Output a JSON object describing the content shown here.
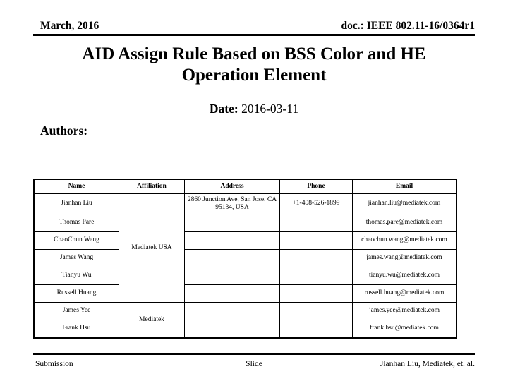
{
  "header": {
    "left": "March, 2016",
    "right": "doc.: IEEE 802.11-16/0364r1"
  },
  "title": "AID Assign Rule Based on BSS Color and HE Operation Element",
  "date": {
    "label": "Date:",
    "value": "2016-03-11"
  },
  "authors_label": "Authors:",
  "authors_table": {
    "columns": [
      "Name",
      "Affiliation",
      "Address",
      "Phone",
      "Email"
    ],
    "rows": [
      {
        "name": "Jianhan Liu",
        "affiliation": "Mediatek USA",
        "address": "2860 Junction Ave, San Jose, CA 95134, USA",
        "phone": "+1-408-526-1899",
        "email": "jianhan.liu@mediatek.com"
      },
      {
        "name": "Thomas Pare",
        "affiliation": "",
        "address": "",
        "phone": "",
        "email": "thomas.pare@mediatek.com"
      },
      {
        "name": "ChaoChun Wang",
        "affiliation": "",
        "address": "",
        "phone": "",
        "email": "chaochun.wang@mediatek.com"
      },
      {
        "name": "James Wang",
        "affiliation": "",
        "address": "",
        "phone": "",
        "email": "james.wang@mediatek.com"
      },
      {
        "name": "Tianyu Wu",
        "affiliation": "",
        "address": "",
        "phone": "",
        "email": "tianyu.wu@mediatek.com"
      },
      {
        "name": "Russell Huang",
        "affiliation": "",
        "address": "",
        "phone": "",
        "email": "russell.huang@mediatek.com"
      },
      {
        "name": "James Yee",
        "affiliation": "Mediatek",
        "address": "",
        "phone": "",
        "email": "james.yee@mediatek.com"
      },
      {
        "name": "Frank Hsu",
        "affiliation": "",
        "address": "",
        "phone": "",
        "email": "frank.hsu@mediatek.com"
      }
    ],
    "affiliation_groups": [
      {
        "label": "Mediatek USA",
        "rowspan": 6,
        "start": 0
      },
      {
        "label": "Mediatek",
        "rowspan": 2,
        "start": 6
      }
    ]
  },
  "footer": {
    "left": "Submission",
    "center": "Slide",
    "right": "Jianhan Liu, Mediatek, et. al."
  },
  "colors": {
    "text": "#000000",
    "background": "#ffffff",
    "rule": "#000000"
  }
}
